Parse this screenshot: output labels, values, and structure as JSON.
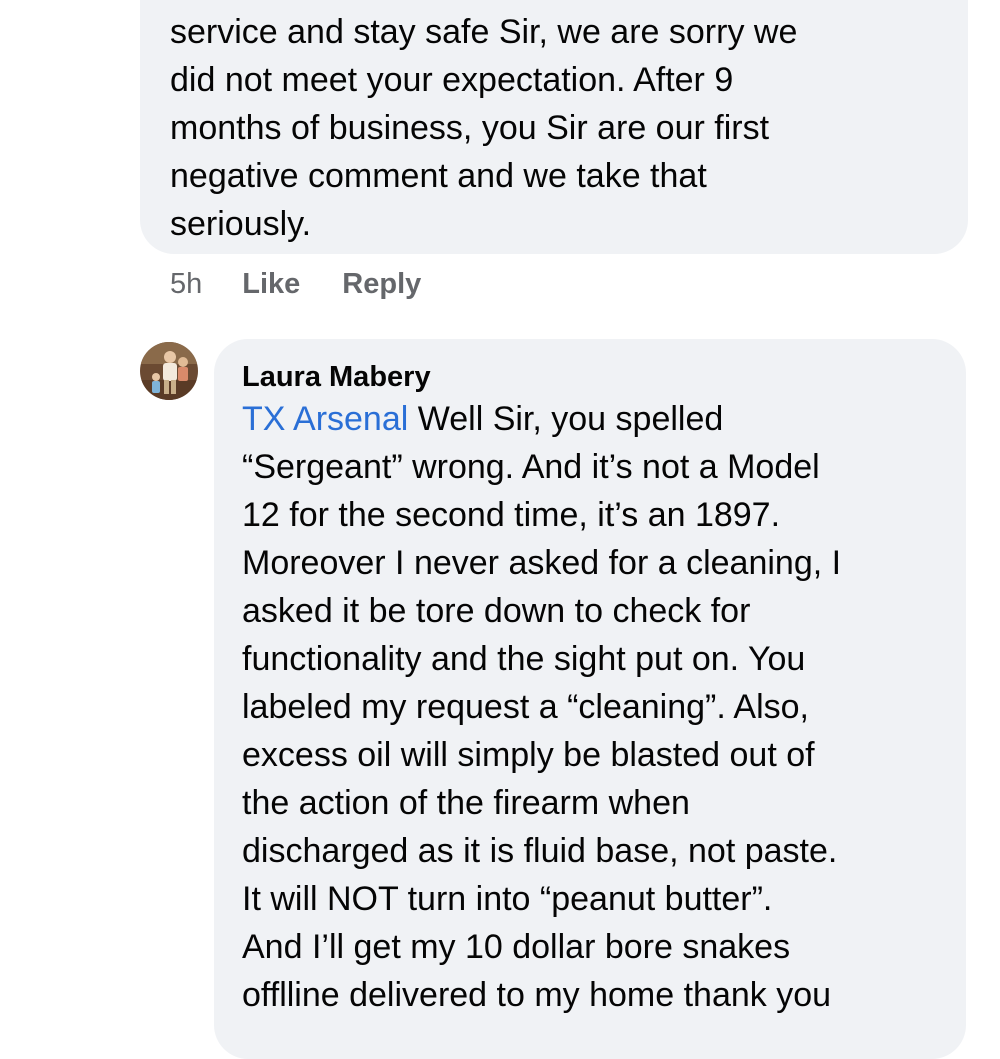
{
  "comments": [
    {
      "text": "service and stay safe Sir, we are sorry we\ndid not meet your expectation. After 9\nmonths of business, you Sir are our first\nnegative comment and we take that\nseriously.",
      "time": "5h",
      "like_label": "Like",
      "reply_label": "Reply"
    },
    {
      "author": "Laura Mabery",
      "avatar_icon": "profile-photo",
      "mention": "TX Arsenal",
      "text": "   Well Sir, you spelled\n“Sergeant” wrong. And it’s not a Model\n12 for the second time, it’s an 1897.\nMoreover I never asked for a cleaning, I\nasked it be tore down to check for\nfunctionality and the sight put on. You\nlabeled my request a “cleaning”.  Also,\nexcess oil will simply be blasted out of\nthe action of the firearm when\ndischarged as it is fluid base, not paste.\nIt will NOT turn into “peanut butter”.\nAnd I’ll get my 10 dollar bore snakes\nofflline delivered to my home thank you"
    }
  ],
  "colors": {
    "bubble": "#f0f2f5",
    "mention": "#2a6fd6",
    "meta": "#65676b"
  }
}
